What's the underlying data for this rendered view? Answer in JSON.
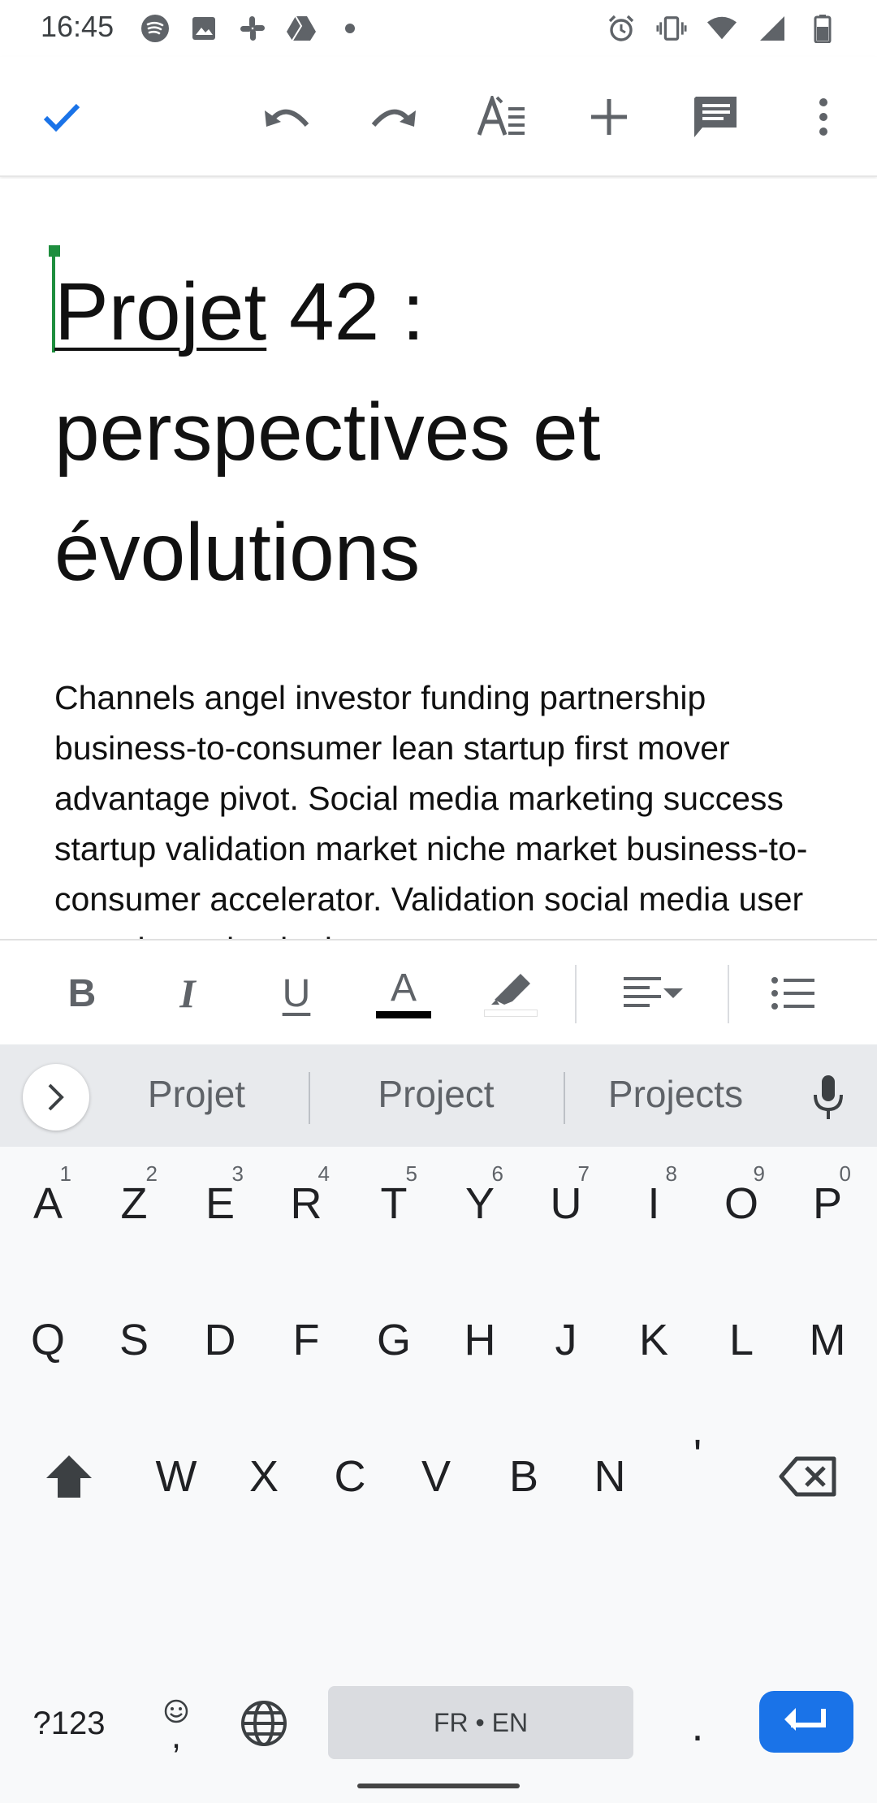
{
  "status": {
    "time": "16:45"
  },
  "toolbar": {
    "icons": [
      "check-icon",
      "undo-icon",
      "redo-icon",
      "text-format-icon",
      "insert-icon",
      "comment-icon",
      "more-vert-icon"
    ]
  },
  "document": {
    "title_underlined": "Projet",
    "title_rest_line1": " 42 :",
    "title_line2": "perspectives et",
    "title_line3": "évolutions",
    "body": "Channels angel investor funding partnership business-to-consumer lean startup first mover advantage pivot. Social media marketing success startup validation market niche market business-to-consumer accelerator. Validation social media user experience hackathon"
  },
  "format_bar": {
    "bold": "B",
    "italic": "I",
    "underline": "U",
    "text_color": "A"
  },
  "keyboard": {
    "suggestions": [
      "Projet",
      "Project",
      "Projects"
    ],
    "row1": [
      {
        "k": "A",
        "n": "1"
      },
      {
        "k": "Z",
        "n": "2"
      },
      {
        "k": "E",
        "n": "3"
      },
      {
        "k": "R",
        "n": "4"
      },
      {
        "k": "T",
        "n": "5"
      },
      {
        "k": "Y",
        "n": "6"
      },
      {
        "k": "U",
        "n": "7"
      },
      {
        "k": "I",
        "n": "8"
      },
      {
        "k": "O",
        "n": "9"
      },
      {
        "k": "P",
        "n": "0"
      }
    ],
    "row2": [
      "Q",
      "S",
      "D",
      "F",
      "G",
      "H",
      "J",
      "K",
      "L",
      "M"
    ],
    "row3": [
      "W",
      "X",
      "C",
      "V",
      "B",
      "N",
      "'"
    ],
    "symbols": "?123",
    "comma": ",",
    "period": ".",
    "space_label": "FR • EN"
  },
  "colors": {
    "accent": "#1a73e8",
    "cursor": "#1e8e3e"
  }
}
